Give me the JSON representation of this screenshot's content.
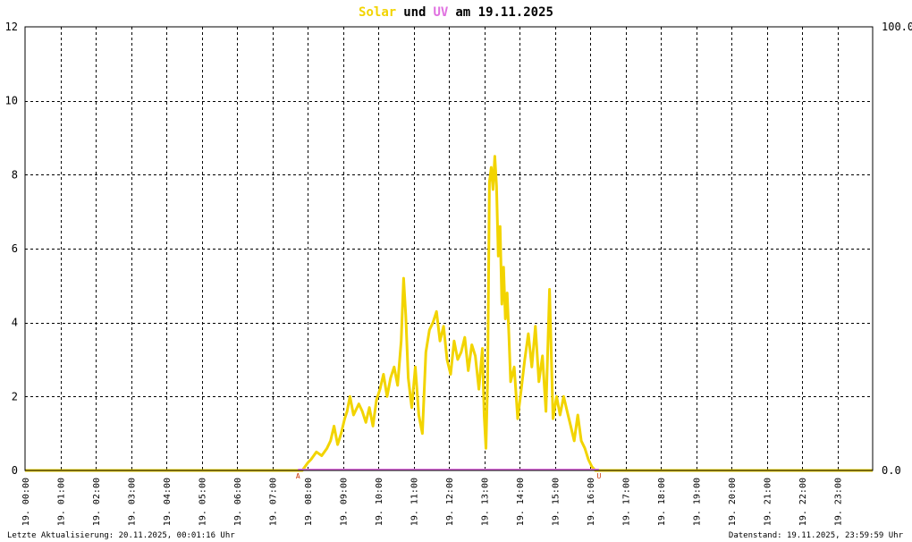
{
  "chart_data": {
    "type": "line",
    "title": {
      "solar_word": "Solar",
      "und_word": "und",
      "uv_word": "UV",
      "rest": "am 19.11.2025"
    },
    "colors": {
      "solar": "#f2d400",
      "uv": "#e070e0",
      "zero_line": "#f07070",
      "sun_markers": "#cc3300",
      "frame": "#000000"
    },
    "y_left": {
      "ylim": [
        0,
        12
      ],
      "ticks": [
        "0",
        "2",
        "4",
        "6",
        "8",
        "10",
        "12"
      ]
    },
    "y_right": {
      "ylim": [
        0,
        100
      ],
      "ticks": [
        "0.0",
        "100.0"
      ]
    },
    "x_axis": {
      "range_hours": [
        0,
        24
      ],
      "tick_labels": [
        "19. 00:00",
        "19. 01:00",
        "19. 02:00",
        "19. 03:00",
        "19. 04:00",
        "19. 05:00",
        "19. 06:00",
        "19. 07:00",
        "19. 08:00",
        "19. 09:00",
        "19. 10:00",
        "19. 11:00",
        "19. 12:00",
        "19. 13:00",
        "19. 14:00",
        "19. 15:00",
        "19. 16:00",
        "19. 17:00",
        "19. 18:00",
        "19. 19:00",
        "19. 20:00",
        "19. 21:00",
        "19. 22:00",
        "19. 23:00"
      ]
    },
    "grid": true,
    "markers": [
      {
        "label": "A",
        "hour": 7.73
      },
      {
        "label": "U",
        "hour": 16.25
      }
    ],
    "series": [
      {
        "name": "Solar",
        "axis": "left",
        "x_hours": [
          0,
          7.85,
          8.0,
          8.1,
          8.25,
          8.4,
          8.55,
          8.65,
          8.75,
          8.85,
          8.95,
          9.05,
          9.12,
          9.2,
          9.3,
          9.45,
          9.55,
          9.65,
          9.75,
          9.85,
          9.95,
          10.05,
          10.15,
          10.25,
          10.35,
          10.45,
          10.55,
          10.65,
          10.72,
          10.78,
          10.85,
          10.95,
          11.05,
          11.15,
          11.25,
          11.35,
          11.45,
          11.55,
          11.65,
          11.75,
          11.85,
          11.95,
          12.05,
          12.15,
          12.25,
          12.35,
          12.45,
          12.55,
          12.65,
          12.75,
          12.85,
          12.95,
          13.0,
          13.05,
          13.1,
          13.15,
          13.2,
          13.25,
          13.3,
          13.35,
          13.4,
          13.45,
          13.5,
          13.55,
          13.6,
          13.65,
          13.7,
          13.75,
          13.85,
          13.95,
          14.05,
          14.15,
          14.25,
          14.35,
          14.45,
          14.55,
          14.65,
          14.75,
          14.85,
          14.95,
          15.05,
          15.15,
          15.25,
          15.35,
          15.45,
          15.55,
          15.65,
          15.75,
          15.85,
          15.95,
          16.05,
          16.15,
          24
        ],
        "values": [
          0,
          0,
          0.2,
          0.3,
          0.5,
          0.4,
          0.6,
          0.8,
          1.2,
          0.7,
          1.0,
          1.4,
          1.6,
          2.0,
          1.5,
          1.8,
          1.6,
          1.3,
          1.7,
          1.2,
          1.9,
          2.2,
          2.6,
          2.0,
          2.5,
          2.8,
          2.3,
          3.5,
          5.2,
          4.2,
          2.5,
          1.7,
          2.8,
          1.5,
          1.0,
          3.2,
          3.8,
          4.0,
          4.3,
          3.5,
          3.9,
          3.0,
          2.6,
          3.5,
          3.0,
          3.2,
          3.6,
          2.7,
          3.4,
          3.1,
          2.2,
          3.3,
          1.5,
          0.6,
          2.5,
          7.8,
          8.2,
          7.6,
          8.5,
          7.7,
          5.8,
          6.6,
          4.5,
          5.5,
          4.1,
          4.8,
          3.7,
          2.4,
          2.8,
          1.4,
          2.2,
          3.0,
          3.7,
          2.8,
          3.9,
          2.4,
          3.1,
          1.6,
          4.9,
          1.4,
          2.0,
          1.5,
          2.0,
          1.6,
          1.2,
          0.8,
          1.5,
          0.8,
          0.6,
          0.3,
          0.1,
          0,
          0
        ]
      },
      {
        "name": "UV",
        "axis": "right",
        "x_hours": [
          0,
          24
        ],
        "values": [
          0,
          0
        ]
      }
    ]
  },
  "footer": {
    "left": "Letzte Aktualisierung: 20.11.2025, 00:01:16 Uhr",
    "right": "Datenstand: 19.11.2025, 23:59:59 Uhr"
  }
}
